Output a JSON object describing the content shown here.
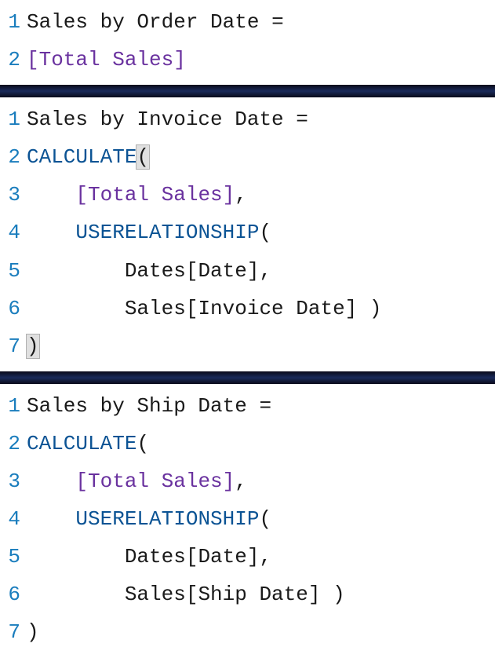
{
  "blocks": [
    {
      "name": "measure-sales-by-order-date",
      "lines": [
        {
          "n": "1",
          "tokens": [
            {
              "cls": "tok-plain",
              "t": "Sales by Order Date "
            },
            {
              "cls": "tok-eq",
              "t": "="
            }
          ]
        },
        {
          "n": "2",
          "tokens": [
            {
              "cls": "tok-measure",
              "t": "[Total Sales]"
            }
          ]
        }
      ]
    },
    {
      "name": "measure-sales-by-invoice-date",
      "lines": [
        {
          "n": "1",
          "tokens": [
            {
              "cls": "tok-plain",
              "t": "Sales by Invoice Date "
            },
            {
              "cls": "tok-eq",
              "t": "="
            }
          ]
        },
        {
          "n": "2",
          "tokens": [
            {
              "cls": "tok-func",
              "t": "CALCULATE"
            },
            {
              "cls": "tok-punc hl-bracket",
              "t": "("
            }
          ]
        },
        {
          "n": "3",
          "tokens": [
            {
              "cls": "tok-plain",
              "t": "    "
            },
            {
              "cls": "tok-measure",
              "t": "[Total Sales]"
            },
            {
              "cls": "tok-punc",
              "t": ","
            }
          ]
        },
        {
          "n": "4",
          "tokens": [
            {
              "cls": "tok-plain",
              "t": "    "
            },
            {
              "cls": "tok-func",
              "t": "USERELATIONSHIP"
            },
            {
              "cls": "tok-punc",
              "t": "("
            }
          ]
        },
        {
          "n": "5",
          "tokens": [
            {
              "cls": "tok-plain",
              "t": "        "
            },
            {
              "cls": "tok-col",
              "t": "Dates[Date]"
            },
            {
              "cls": "tok-punc",
              "t": ","
            }
          ]
        },
        {
          "n": "6",
          "tokens": [
            {
              "cls": "tok-plain",
              "t": "        "
            },
            {
              "cls": "tok-col",
              "t": "Sales[Invoice Date]"
            },
            {
              "cls": "tok-plain",
              "t": " "
            },
            {
              "cls": "tok-punc",
              "t": ")"
            }
          ]
        },
        {
          "n": "7",
          "tokens": [
            {
              "cls": "tok-punc hl-bracket",
              "t": ")"
            }
          ]
        }
      ]
    },
    {
      "name": "measure-sales-by-ship-date",
      "lines": [
        {
          "n": "1",
          "tokens": [
            {
              "cls": "tok-plain",
              "t": "Sales by Ship Date "
            },
            {
              "cls": "tok-eq",
              "t": "="
            }
          ]
        },
        {
          "n": "2",
          "tokens": [
            {
              "cls": "tok-func",
              "t": "CALCULATE"
            },
            {
              "cls": "tok-punc",
              "t": "("
            }
          ]
        },
        {
          "n": "3",
          "tokens": [
            {
              "cls": "tok-plain",
              "t": "    "
            },
            {
              "cls": "tok-measure",
              "t": "[Total Sales]"
            },
            {
              "cls": "tok-punc",
              "t": ","
            }
          ]
        },
        {
          "n": "4",
          "tokens": [
            {
              "cls": "tok-plain",
              "t": "    "
            },
            {
              "cls": "tok-func",
              "t": "USERELATIONSHIP"
            },
            {
              "cls": "tok-punc",
              "t": "("
            }
          ]
        },
        {
          "n": "5",
          "tokens": [
            {
              "cls": "tok-plain",
              "t": "        "
            },
            {
              "cls": "tok-col",
              "t": "Dates[Date]"
            },
            {
              "cls": "tok-punc",
              "t": ","
            }
          ]
        },
        {
          "n": "6",
          "tokens": [
            {
              "cls": "tok-plain",
              "t": "        "
            },
            {
              "cls": "tok-col",
              "t": "Sales[Ship Date]"
            },
            {
              "cls": "tok-plain",
              "t": " "
            },
            {
              "cls": "tok-punc",
              "t": ")"
            }
          ]
        },
        {
          "n": "7",
          "tokens": [
            {
              "cls": "tok-punc",
              "t": ")"
            }
          ]
        }
      ]
    }
  ]
}
